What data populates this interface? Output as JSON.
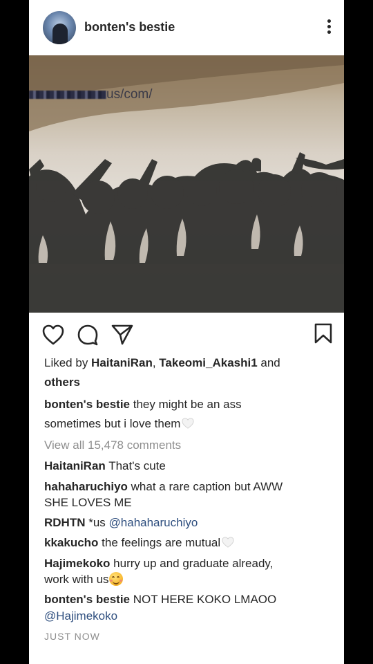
{
  "post": {
    "username": "bonten's bestie",
    "watermark_text": "us/com/",
    "liked_by": {
      "prefix": "Liked by ",
      "user1": "HaitaniRan",
      "sep": ", ",
      "user2": "Takeomi_Akashi1",
      "and": " and",
      "others": "others"
    },
    "caption": {
      "username": "bonten's bestie",
      "line1": " they might be an ass",
      "line2": "sometimes but i love them"
    },
    "view_all": "View all 15,478 comments",
    "comments": [
      {
        "user": "HaitaniRan",
        "text": " That's cute"
      },
      {
        "user": "hahaharuchiyo",
        "text": " what a rare caption but AWW",
        "text2": "SHE LOVES ME"
      },
      {
        "user": "RDHTN",
        "text": " *us ",
        "mention": "@hahaharuchiyo"
      },
      {
        "user": "kkakucho",
        "text": " the feelings are mutual"
      },
      {
        "user": "Hajimekoko",
        "text": " hurry up and graduate already,",
        "text2": "work with us"
      },
      {
        "user": "bonten's bestie",
        "text": " NOT HERE KOKO LMAOO",
        "mention": "@Hajimekoko"
      }
    ],
    "timestamp": "JUST NOW"
  },
  "icons": {
    "like": "heart-outline-icon",
    "comment": "comment-bubble-icon",
    "share": "paper-plane-icon",
    "save": "bookmark-icon",
    "more": "vertical-dots-icon"
  },
  "colors": {
    "text": "#262626",
    "muted": "#8e8e8e",
    "mention": "#2f4f7f",
    "background": "#000000"
  }
}
